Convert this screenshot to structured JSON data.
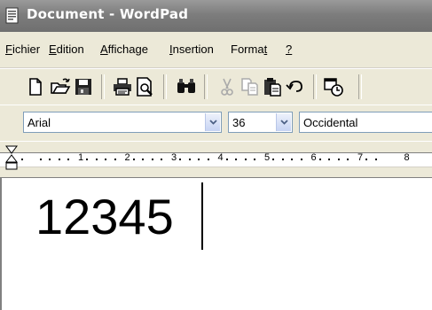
{
  "window": {
    "title": "Document - WordPad"
  },
  "menu": {
    "items": [
      {
        "pre": "",
        "u": "F",
        "post": "ichier"
      },
      {
        "pre": "",
        "u": "E",
        "post": "dition"
      },
      {
        "pre": "",
        "u": "A",
        "post": "ffichage"
      },
      {
        "pre": "",
        "u": "I",
        "post": "nsertion"
      },
      {
        "pre": "Forma",
        "u": "t",
        "post": ""
      },
      {
        "pre": "",
        "u": "?",
        "post": ""
      }
    ]
  },
  "toolbar": {
    "icons": [
      "new-icon",
      "open-icon",
      "save-icon",
      "print-icon",
      "print-preview-icon",
      "find-icon",
      "cut-icon",
      "copy-icon",
      "paste-icon",
      "undo-icon",
      "date-time-icon"
    ]
  },
  "format": {
    "font": "Arial",
    "size": "36",
    "script": "Occidental"
  },
  "ruler": {
    "numbers": [
      "1",
      "2",
      "3",
      "4",
      "5",
      "6",
      "7",
      "8"
    ]
  },
  "document": {
    "text": "12345"
  }
}
